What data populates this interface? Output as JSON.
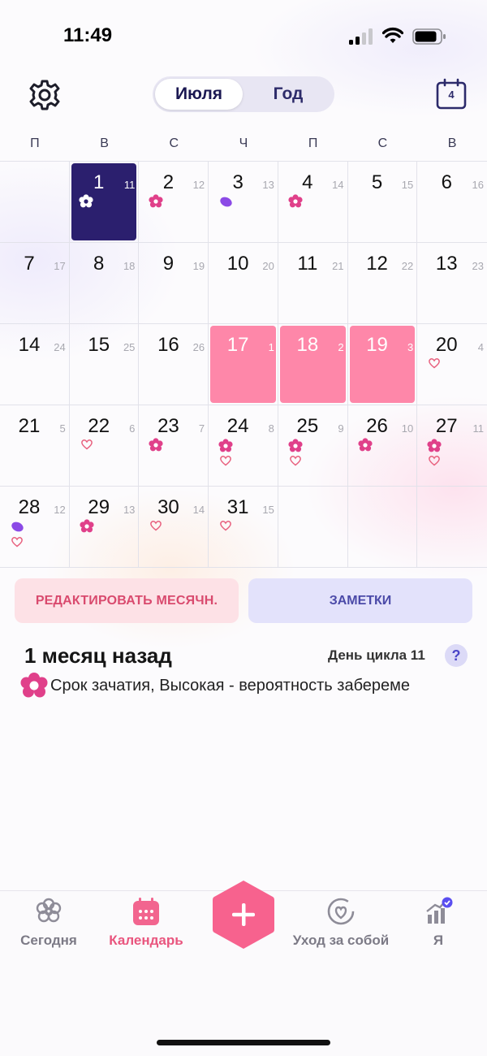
{
  "status": {
    "time": "11:49"
  },
  "header": {
    "segments": [
      "Июля",
      "Год"
    ],
    "active_segment": 0,
    "calendar_button_day": "4"
  },
  "weekdays": [
    "П",
    "В",
    "С",
    "Ч",
    "П",
    "С",
    "В"
  ],
  "calendar": {
    "cells": [
      {
        "day": "",
        "cyc": ""
      },
      {
        "day": "1",
        "cyc": "11",
        "state": "selected",
        "icon": "flower-white"
      },
      {
        "day": "2",
        "cyc": "12",
        "icon": "flower"
      },
      {
        "day": "3",
        "cyc": "13",
        "icon": "oval"
      },
      {
        "day": "4",
        "cyc": "14",
        "icon": "flower"
      },
      {
        "day": "5",
        "cyc": "15"
      },
      {
        "day": "6",
        "cyc": "16"
      },
      {
        "day": "7",
        "cyc": "17"
      },
      {
        "day": "8",
        "cyc": "18"
      },
      {
        "day": "9",
        "cyc": "19"
      },
      {
        "day": "10",
        "cyc": "20"
      },
      {
        "day": "11",
        "cyc": "21"
      },
      {
        "day": "12",
        "cyc": "22"
      },
      {
        "day": "13",
        "cyc": "23"
      },
      {
        "day": "14",
        "cyc": "24"
      },
      {
        "day": "15",
        "cyc": "25"
      },
      {
        "day": "16",
        "cyc": "26"
      },
      {
        "day": "17",
        "cyc": "1",
        "state": "period"
      },
      {
        "day": "18",
        "cyc": "2",
        "state": "period"
      },
      {
        "day": "19",
        "cyc": "3",
        "state": "period"
      },
      {
        "day": "20",
        "cyc": "4",
        "icon": "heart"
      },
      {
        "day": "21",
        "cyc": "5"
      },
      {
        "day": "22",
        "cyc": "6",
        "icon": "heart"
      },
      {
        "day": "23",
        "cyc": "7",
        "icon": "flower"
      },
      {
        "day": "24",
        "cyc": "8",
        "icon": "flower-heart"
      },
      {
        "day": "25",
        "cyc": "9",
        "icon": "flower-heart"
      },
      {
        "day": "26",
        "cyc": "10",
        "icon": "flower"
      },
      {
        "day": "27",
        "cyc": "11",
        "icon": "flower-heart"
      },
      {
        "day": "28",
        "cyc": "12",
        "icon": "oval-heart"
      },
      {
        "day": "29",
        "cyc": "13",
        "icon": "flower"
      },
      {
        "day": "30",
        "cyc": "14",
        "icon": "heart"
      },
      {
        "day": "31",
        "cyc": "15",
        "icon": "heart"
      },
      {
        "day": "",
        "cyc": ""
      },
      {
        "day": "",
        "cyc": ""
      },
      {
        "day": "",
        "cyc": ""
      }
    ]
  },
  "actions": {
    "edit_label": "РЕДАКТИРОВАТЬ МЕСЯЧН.",
    "notes_label": "ЗАМЕТКИ"
  },
  "info": {
    "ago": "1 месяц назад",
    "cycle_day": "День цикла 11",
    "help": "?",
    "note": "Срок зачатия, Высокая - вероятность забереме"
  },
  "tabs": [
    {
      "label": "Сегодня",
      "icon": "flower-outline-icon"
    },
    {
      "label": "Календарь",
      "icon": "calendar-icon"
    },
    {
      "label": "",
      "icon": "plus-icon"
    },
    {
      "label": "Уход за собой",
      "icon": "heart-ring-icon"
    },
    {
      "label": "Я",
      "icon": "chart-icon"
    }
  ],
  "colors": {
    "accent_pink": "#fe87a9",
    "selected_navy": "#2b1f6e",
    "flower_pink": "#e0408a",
    "oval_purple": "#8b4ae6",
    "tab_active": "#e9557e"
  }
}
